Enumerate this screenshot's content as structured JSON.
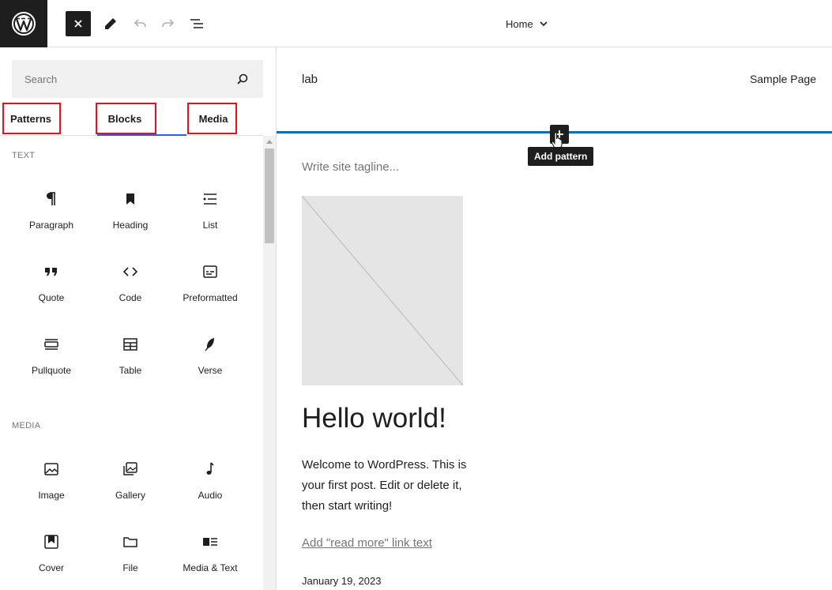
{
  "toolbar": {
    "logo_icon": "wordpress-logo-icon",
    "close_icon": "close-icon",
    "tools_icon": "pencil-icon",
    "undo_icon": "undo-icon",
    "redo_icon": "redo-icon",
    "list_view_icon": "list-view-icon",
    "document_title": "Home",
    "title_dropdown_icon": "chevron-down-icon"
  },
  "inserter": {
    "search": {
      "placeholder": "Search",
      "value": "",
      "icon": "search-icon"
    },
    "tabs": [
      {
        "label": "Patterns"
      },
      {
        "label": "Blocks",
        "active": true
      },
      {
        "label": "Media"
      }
    ],
    "categories": [
      {
        "label": "Text",
        "blocks": [
          {
            "label": "Paragraph",
            "icon": "paragraph-icon"
          },
          {
            "label": "Heading",
            "icon": "heading-bookmark-icon"
          },
          {
            "label": "List",
            "icon": "list-icon"
          },
          {
            "label": "Quote",
            "icon": "quote-icon"
          },
          {
            "label": "Code",
            "icon": "code-icon"
          },
          {
            "label": "Preformatted",
            "icon": "preformatted-icon"
          },
          {
            "label": "Pullquote",
            "icon": "pullquote-icon"
          },
          {
            "label": "Table",
            "icon": "table-icon"
          },
          {
            "label": "Verse",
            "icon": "verse-feather-icon"
          }
        ]
      },
      {
        "label": "Media",
        "blocks": [
          {
            "label": "Image",
            "icon": "image-icon"
          },
          {
            "label": "Gallery",
            "icon": "gallery-icon"
          },
          {
            "label": "Audio",
            "icon": "audio-icon"
          },
          {
            "label": "Cover",
            "icon": "cover-icon"
          },
          {
            "label": "File",
            "icon": "folder-icon"
          },
          {
            "label": "Media & Text",
            "icon": "media-text-icon"
          }
        ]
      }
    ],
    "highlight_color": "#e8101a",
    "accent_color": "#3858e9"
  },
  "canvas": {
    "site_title": "lab",
    "nav_link": "Sample Page",
    "insertion_tooltip": "Add pattern",
    "insertion_color": "#0f6fa7",
    "tagline_placeholder": "Write site tagline...",
    "post_title": "Hello world!",
    "post_excerpt": "Welcome to WordPress. This is your first post. Edit or delete it, then start writing!",
    "read_more": "Add \"read more\" link text",
    "post_date": "January 19, 2023"
  }
}
